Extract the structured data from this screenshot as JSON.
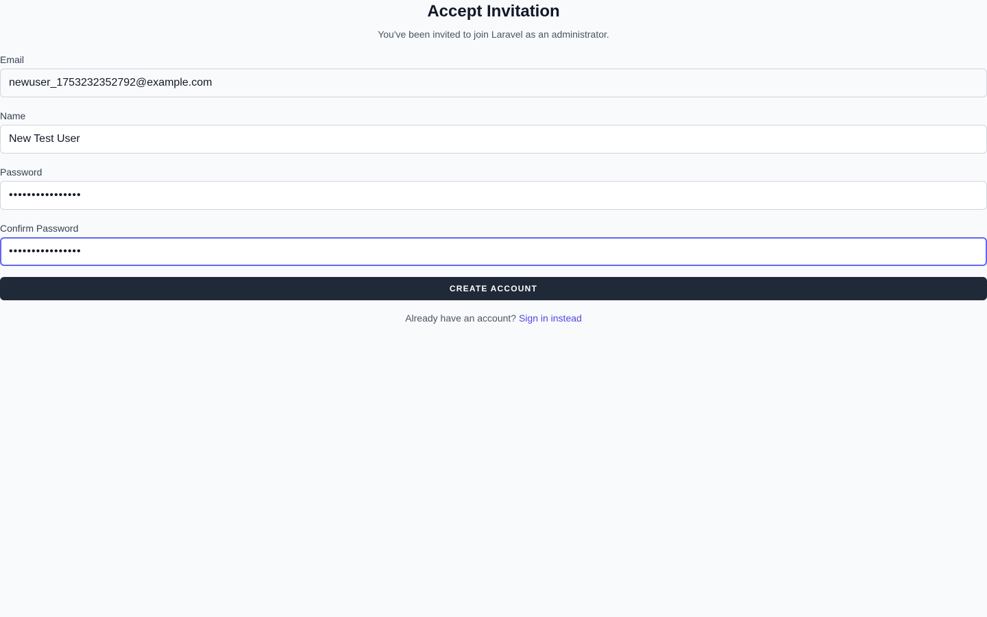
{
  "header": {
    "title": "Accept Invitation",
    "subtitle": "You've been invited to join Laravel as an administrator."
  },
  "form": {
    "email": {
      "label": "Email",
      "value": "newuser_1753232352792@example.com"
    },
    "name": {
      "label": "Name",
      "value": "New Test User"
    },
    "password": {
      "label": "Password",
      "value": "••••••••••••••••"
    },
    "confirm_password": {
      "label": "Confirm Password",
      "value": "••••••••••••••••"
    },
    "submit_label": "CREATE ACCOUNT"
  },
  "footer": {
    "prompt": "Already have an account?",
    "link_label": "Sign in instead"
  },
  "colors": {
    "background": "#f8fafc",
    "button": "#1f2937",
    "link": "#4f46e5",
    "focus_ring": "#6366f1"
  }
}
